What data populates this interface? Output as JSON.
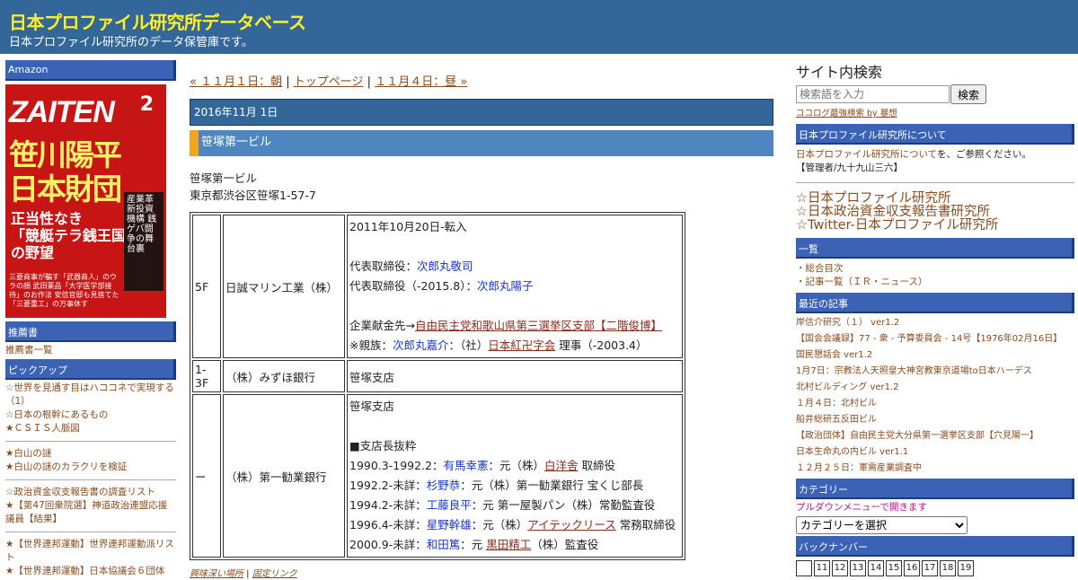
{
  "header": {
    "title": "日本プロファイル研究所データベース",
    "desc": "日本プロファイル研究所のデータ保管庫です。"
  },
  "left": {
    "amazon_title": "Amazon",
    "cover": {
      "logo": "ZAITEN",
      "issue": "2",
      "big1": "笹川陽平",
      "big2": "日本財団",
      "sub1": "正当性なき",
      "sub2": "「競艇テラ銭王国」",
      "sub3": "の野望",
      "side": "産業革新投資機構 銭ゲバ闘争の舞台裏",
      "foot": "三菱商事が騙す「武器商人」のウラの顔 武田薬品「大学医学部接待」のお作法 安倍官邸も見捨てた「三菱重工」の万事休す"
    },
    "recommend_title": "推薦書",
    "recommend_link": "推薦書一覧",
    "pickup_title": "ピックアップ",
    "pickup1": [
      "☆世界を見通す目はハココネで実現する（1）",
      "☆日本の根幹にあるもの",
      "★ＣＳＩＳ人脈図"
    ],
    "pickup2": [
      "★白山の謎",
      "★白山の謎のカラクリを検証"
    ],
    "pickup3": [
      "☆政治資金収支報告書の調査リスト",
      "★【第47回衆院選】神道政治連盟応援議員【結果】"
    ],
    "pickup4": [
      "★【世界連邦運動】世界連邦運動派リスト",
      "★【世界連邦運動】日本協議会６団体"
    ]
  },
  "main": {
    "nav": {
      "prev": "« １１月１日：朝",
      "top": "トップページ",
      "next": "１１月４日：昼 »",
      "sep": "|"
    },
    "date": "2016年11月 1日",
    "title": "笹塚第一ビル",
    "addr1": "笹塚第一ビル",
    "addr2": "東京都渋谷区笹塚1-57-7",
    "rows": [
      {
        "floor": "5F",
        "name": "日誠マリン工業（株）"
      },
      {
        "floor": "1-3F",
        "name": "（株）みずほ銀行",
        "note": "笹塚支店"
      },
      {
        "floor": "ー",
        "name": "（株）第一勧業銀行"
      }
    ],
    "r1": {
      "l1": "2011年10月20日-転入",
      "l2a": "代表取締役：",
      "l2b": "次郎丸敬司",
      "l3a": "代表取締役（-2015.8）：",
      "l3b": "次郎丸陽子",
      "l4a": "企業献金先→",
      "l4b": "自由民主党和歌山県第三選挙区支部【二階俊博】",
      "l5a": "※親族：",
      "l5b": "次郎丸嘉介",
      "l5c": "：（社）",
      "l5d": "日本紅卍字会",
      "l5e": " 理事（-2003.4）"
    },
    "r3": {
      "l1": "笹塚支店",
      "l2": "■支店長抜粋",
      "lines": [
        {
          "a": "1990.3-1992.2：",
          "b": "有馬幸憲",
          "c": "：元（株）",
          "d": "白洋舎",
          "e": " 取締役"
        },
        {
          "a": "1992.2-未詳：",
          "b": "杉野恭",
          "c": "：元（株）第一勧業銀行 宝くじ部長",
          "d": "",
          "e": ""
        },
        {
          "a": "1994.2-未詳：",
          "b": "工藤良平",
          "c": "：元 第一屋製パン（株）常勤監査役",
          "d": "",
          "e": ""
        },
        {
          "a": "1996.4-未詳：",
          "b": "星野幹雄",
          "c": "：元（株）",
          "d": "アイテックリース",
          "e": " 常務取締役"
        },
        {
          "a": "2000.9-未詳：",
          "b": "和田篤",
          "c": "：元 ",
          "d": "黒田精工",
          "e": "（株）監査役"
        }
      ]
    },
    "perma1": "興味深い場所",
    "perma2": "固定リンク"
  },
  "right": {
    "search_title": "サイト内検索",
    "search_placeholder": "検索語を入力",
    "search_button": "検索",
    "powered": "ココログ最強検索 by 暴想",
    "about_title": "日本プロファイル研究所について",
    "about_text1": "日本プロファイル研究所について",
    "about_text2": "を、ご参照ください。",
    "about_admin": "【管理者/九十九山三六】",
    "links": [
      "☆日本プロファイル研究所",
      "☆日本政治資金収支報告書研究所",
      "☆Twitter-日本プロファイル研究所"
    ],
    "index_title": "一覧",
    "index_items": [
      "・総合目次",
      "・記事一覧（ＩＲ・ニュース）"
    ],
    "recent_title": "最近の記事",
    "recent": [
      "岸信介研究（１） ver1.2",
      "【国会会議録】77 - 衆 - 予算委員会 - 14号【1976年02月16日】",
      "国民懇話会 ver1.2",
      "1月7日：宗教法人天照皇大神宮教東京道場to日本ハーデス",
      "北村ビルディング ver1.2",
      "１月４日：北村ビル",
      "船井総研五反田ビル",
      "【政治団体】自由民主党大分県第一選挙区支部【穴見陽一】",
      "日本生命丸の内ビル ver1.1",
      "１２月２５日：軍需産業調査中"
    ],
    "cat_title": "カテゴリー",
    "cat_note": "プルダウンメニューで開きます",
    "cat_select": "カテゴリーを選択",
    "back_title": "バックナンバー",
    "back_nums": [
      "",
      "11",
      "12",
      "13",
      "14",
      "15",
      "16",
      "17",
      "18",
      "19"
    ]
  }
}
